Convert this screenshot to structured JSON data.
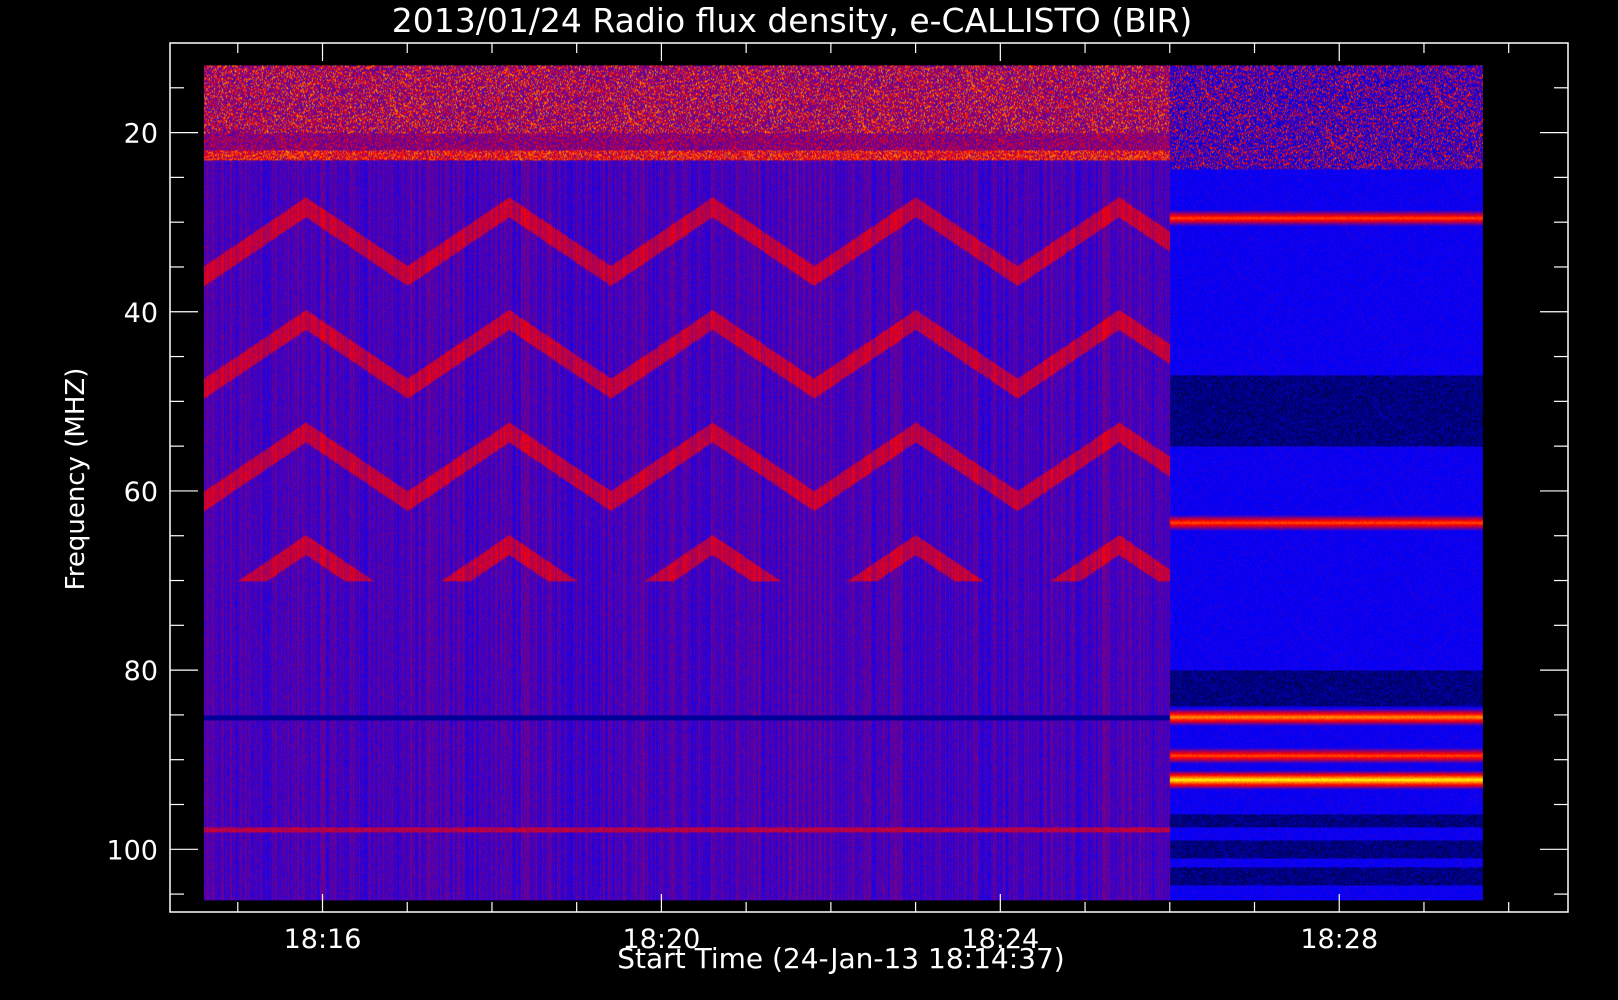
{
  "chart_data": {
    "type": "heatmap",
    "title": "2013/01/24  Radio flux density, e-CALLISTO (BIR)",
    "xlabel": "Start Time (24-Jan-13 18:14:37)",
    "ylabel": "Frequency (MHZ)",
    "x_ticks": [
      "18:16",
      "18:20",
      "18:24",
      "18:28"
    ],
    "x_tick_minutes": [
      16,
      20,
      24,
      28
    ],
    "x_range_minutes": [
      14.2,
      30.7
    ],
    "data_time_range_minutes": [
      14.6,
      29.7
    ],
    "y_ticks": [
      20,
      40,
      60,
      80,
      100
    ],
    "y_range": [
      10,
      107
    ],
    "y_inverted": true,
    "data_freq_range": [
      12.5,
      105.7
    ],
    "segment_break_minute": 26.0,
    "colormap": [
      "#000000",
      "#0000ff",
      "#ff0000",
      "#ffff00",
      "#ffffff"
    ],
    "bright_bands_segment2": [
      {
        "freq": 29.5,
        "level": "red"
      },
      {
        "freq": 63.5,
        "level": "red"
      },
      {
        "freq": 85.2,
        "level": "orange"
      },
      {
        "freq": 89.5,
        "level": "red"
      },
      {
        "freq": 92.2,
        "level": "yellow"
      }
    ]
  }
}
